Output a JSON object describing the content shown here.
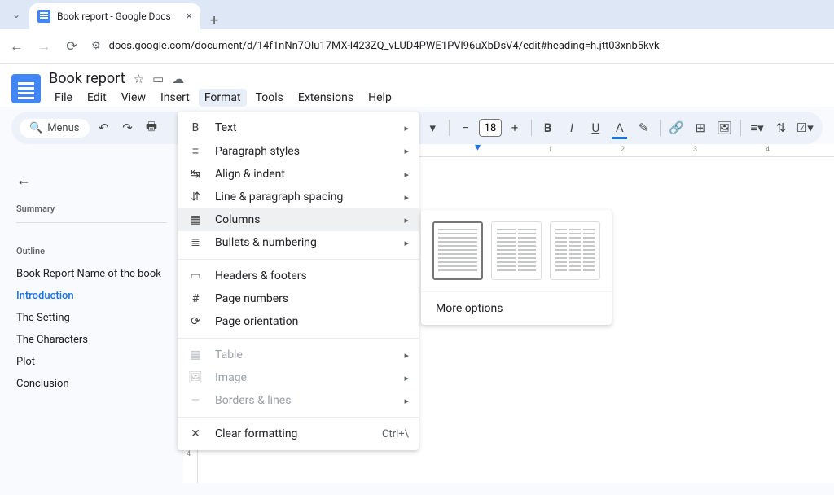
{
  "browser": {
    "tab_title": "Book report - Google Docs",
    "url": "docs.google.com/document/d/14f1nNn7Olu17MX-l423ZQ_vLUD4PWE1PVl96uXbDsV4/edit#heading=h.jtt03xnb5kvk"
  },
  "docs": {
    "title": "Book report",
    "menus": [
      "File",
      "Edit",
      "View",
      "Insert",
      "Format",
      "Tools",
      "Extensions",
      "Help"
    ],
    "active_menu_index": 4
  },
  "toolbar": {
    "menus_label": "Menus",
    "font_size": "18"
  },
  "ruler": {
    "marks": [
      "1",
      "2",
      "3",
      "4"
    ]
  },
  "outline": {
    "summary_label": "Summary",
    "outline_label": "Outline",
    "items": [
      {
        "label": "Book Report Name of the book",
        "active": false
      },
      {
        "label": "Introduction",
        "active": true
      },
      {
        "label": "The Setting",
        "active": false
      },
      {
        "label": "The Characters",
        "active": false
      },
      {
        "label": "Plot",
        "active": false
      },
      {
        "label": "Conclusion",
        "active": false
      }
    ]
  },
  "format_menu": {
    "items": [
      {
        "label": "Text",
        "submenu": true,
        "group": 0
      },
      {
        "label": "Paragraph styles",
        "submenu": true,
        "group": 0
      },
      {
        "label": "Align & indent",
        "submenu": true,
        "group": 0
      },
      {
        "label": "Line & paragraph spacing",
        "submenu": true,
        "group": 0
      },
      {
        "label": "Columns",
        "submenu": true,
        "group": 0,
        "hovered": true
      },
      {
        "label": "Bullets & numbering",
        "submenu": true,
        "group": 0
      },
      {
        "label": "Headers & footers",
        "submenu": false,
        "group": 1
      },
      {
        "label": "Page numbers",
        "submenu": false,
        "group": 1
      },
      {
        "label": "Page orientation",
        "submenu": false,
        "group": 1
      },
      {
        "label": "Table",
        "submenu": true,
        "group": 2,
        "disabled": true
      },
      {
        "label": "Image",
        "submenu": true,
        "group": 2,
        "disabled": true
      },
      {
        "label": "Borders & lines",
        "submenu": true,
        "group": 2,
        "disabled": true
      },
      {
        "label": "Clear formatting",
        "submenu": false,
        "group": 3,
        "shortcut": "Ctrl+\\"
      }
    ]
  },
  "columns_submenu": {
    "more_label": "More options"
  }
}
